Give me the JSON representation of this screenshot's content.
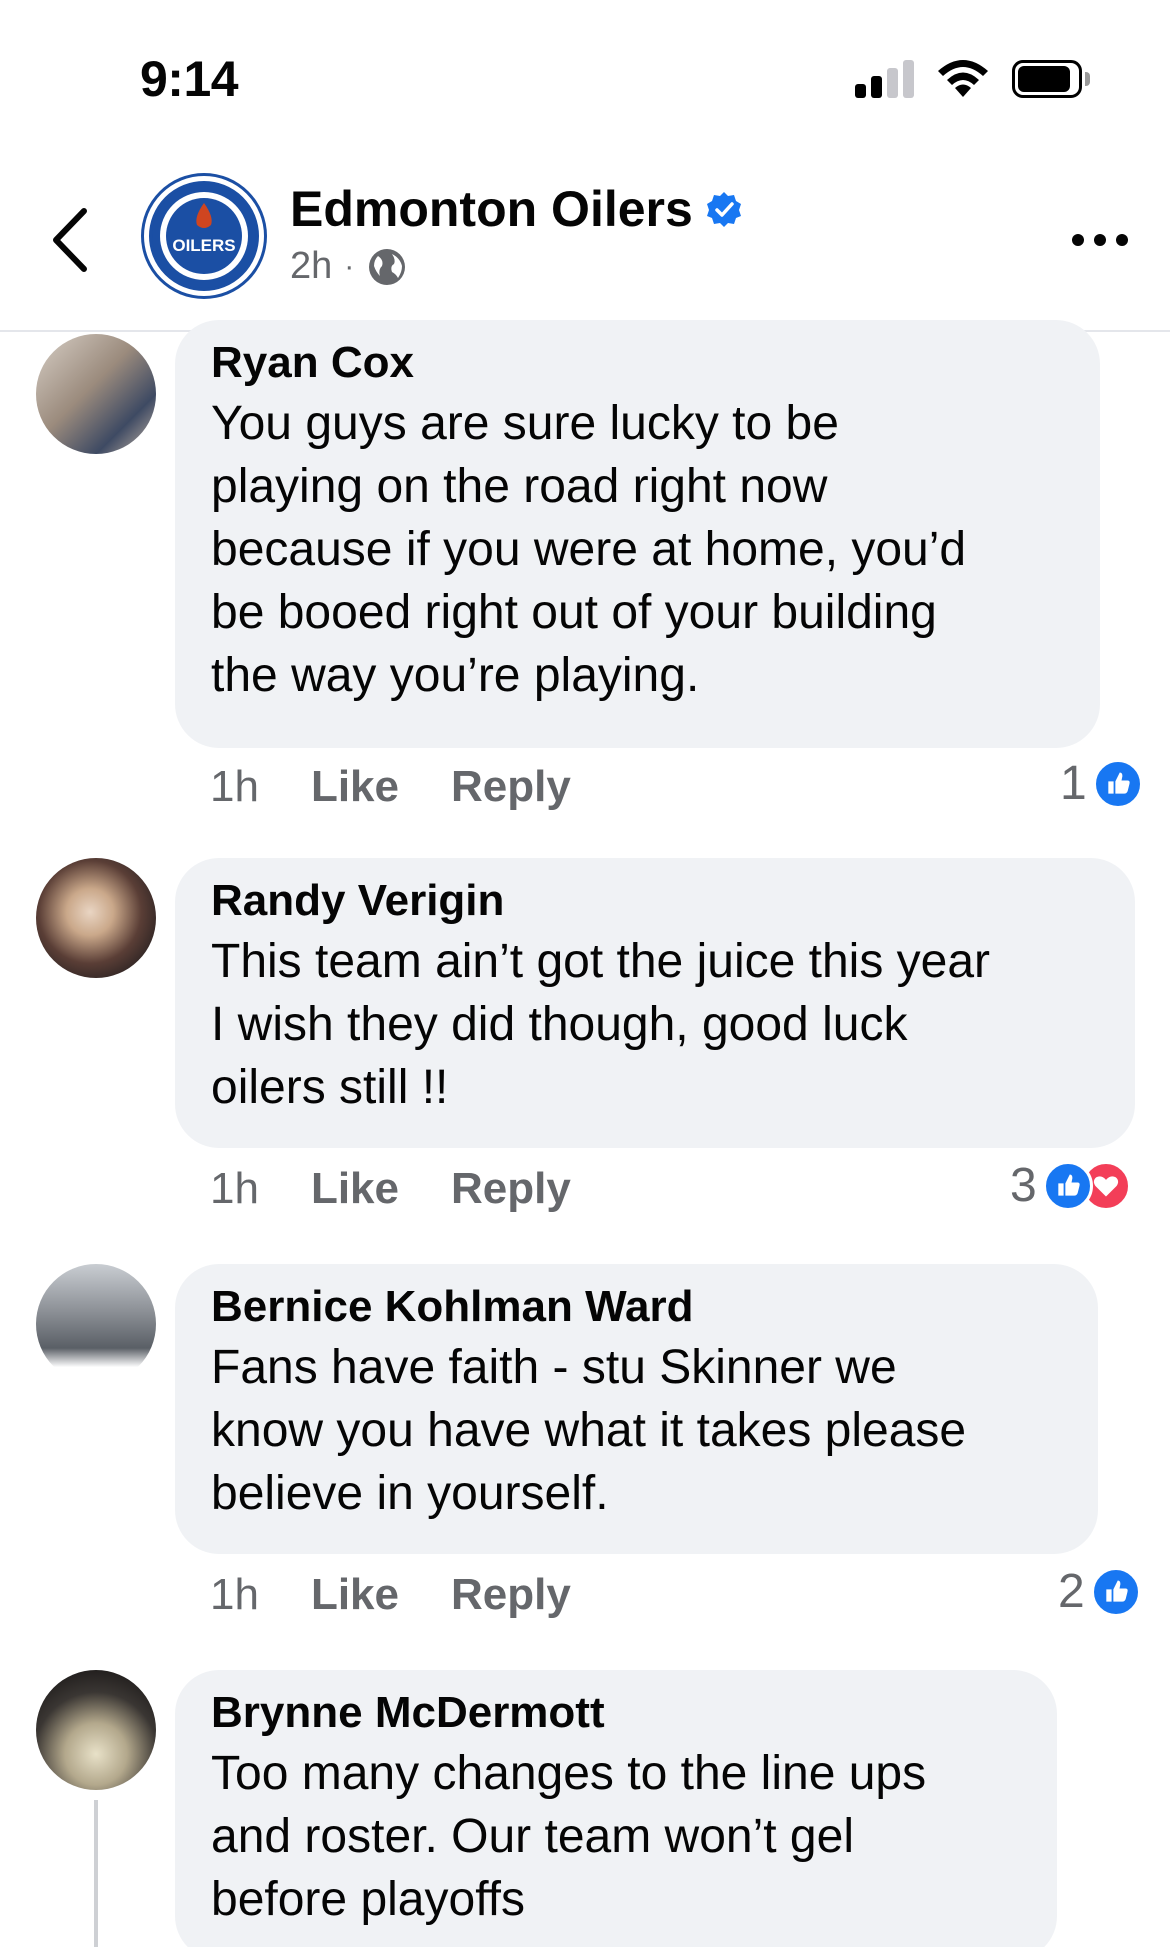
{
  "status_bar": {
    "time": "9:14"
  },
  "header": {
    "page_name": "Edmonton Oilers",
    "timestamp": "2h",
    "separator": "·",
    "logo_text": "OILERS"
  },
  "comments": [
    {
      "author": "Ryan Cox",
      "lines": [
        "You guys are sure lucky to be",
        "playing on the road right now",
        "because if you were at home, you’d",
        "be booed right out of your building",
        "the way you’re playing."
      ],
      "time": "1h",
      "like_label": "Like",
      "reply_label": "Reply",
      "reaction_count": "1",
      "reactions": [
        "like-icon"
      ]
    },
    {
      "author": "Randy Verigin",
      "lines": [
        "This team ain’t got the juice this year",
        "I wish they did though, good luck",
        "oilers still !!"
      ],
      "time": "1h",
      "like_label": "Like",
      "reply_label": "Reply",
      "reaction_count": "3",
      "reactions": [
        "like-icon",
        "love-icon"
      ]
    },
    {
      "author": "Bernice Kohlman Ward",
      "lines": [
        "Fans have faith - stu Skinner we",
        "know you have what it takes please",
        "believe in yourself."
      ],
      "time": "1h",
      "like_label": "Like",
      "reply_label": "Reply",
      "reaction_count": "2",
      "reactions": [
        "like-icon"
      ]
    },
    {
      "author": "Brynne McDermott",
      "lines": [
        "Too many changes to the line ups",
        "and roster. Our team won’t gel",
        "before playoffs"
      ]
    }
  ],
  "colors": {
    "facebook_blue": "#1877f2",
    "love_red": "#f33e58",
    "bubble_bg": "#f0f2f5",
    "secondary_text": "#65676b",
    "oilers_blue": "#1b4fa4",
    "oilers_orange": "#cf4520"
  }
}
